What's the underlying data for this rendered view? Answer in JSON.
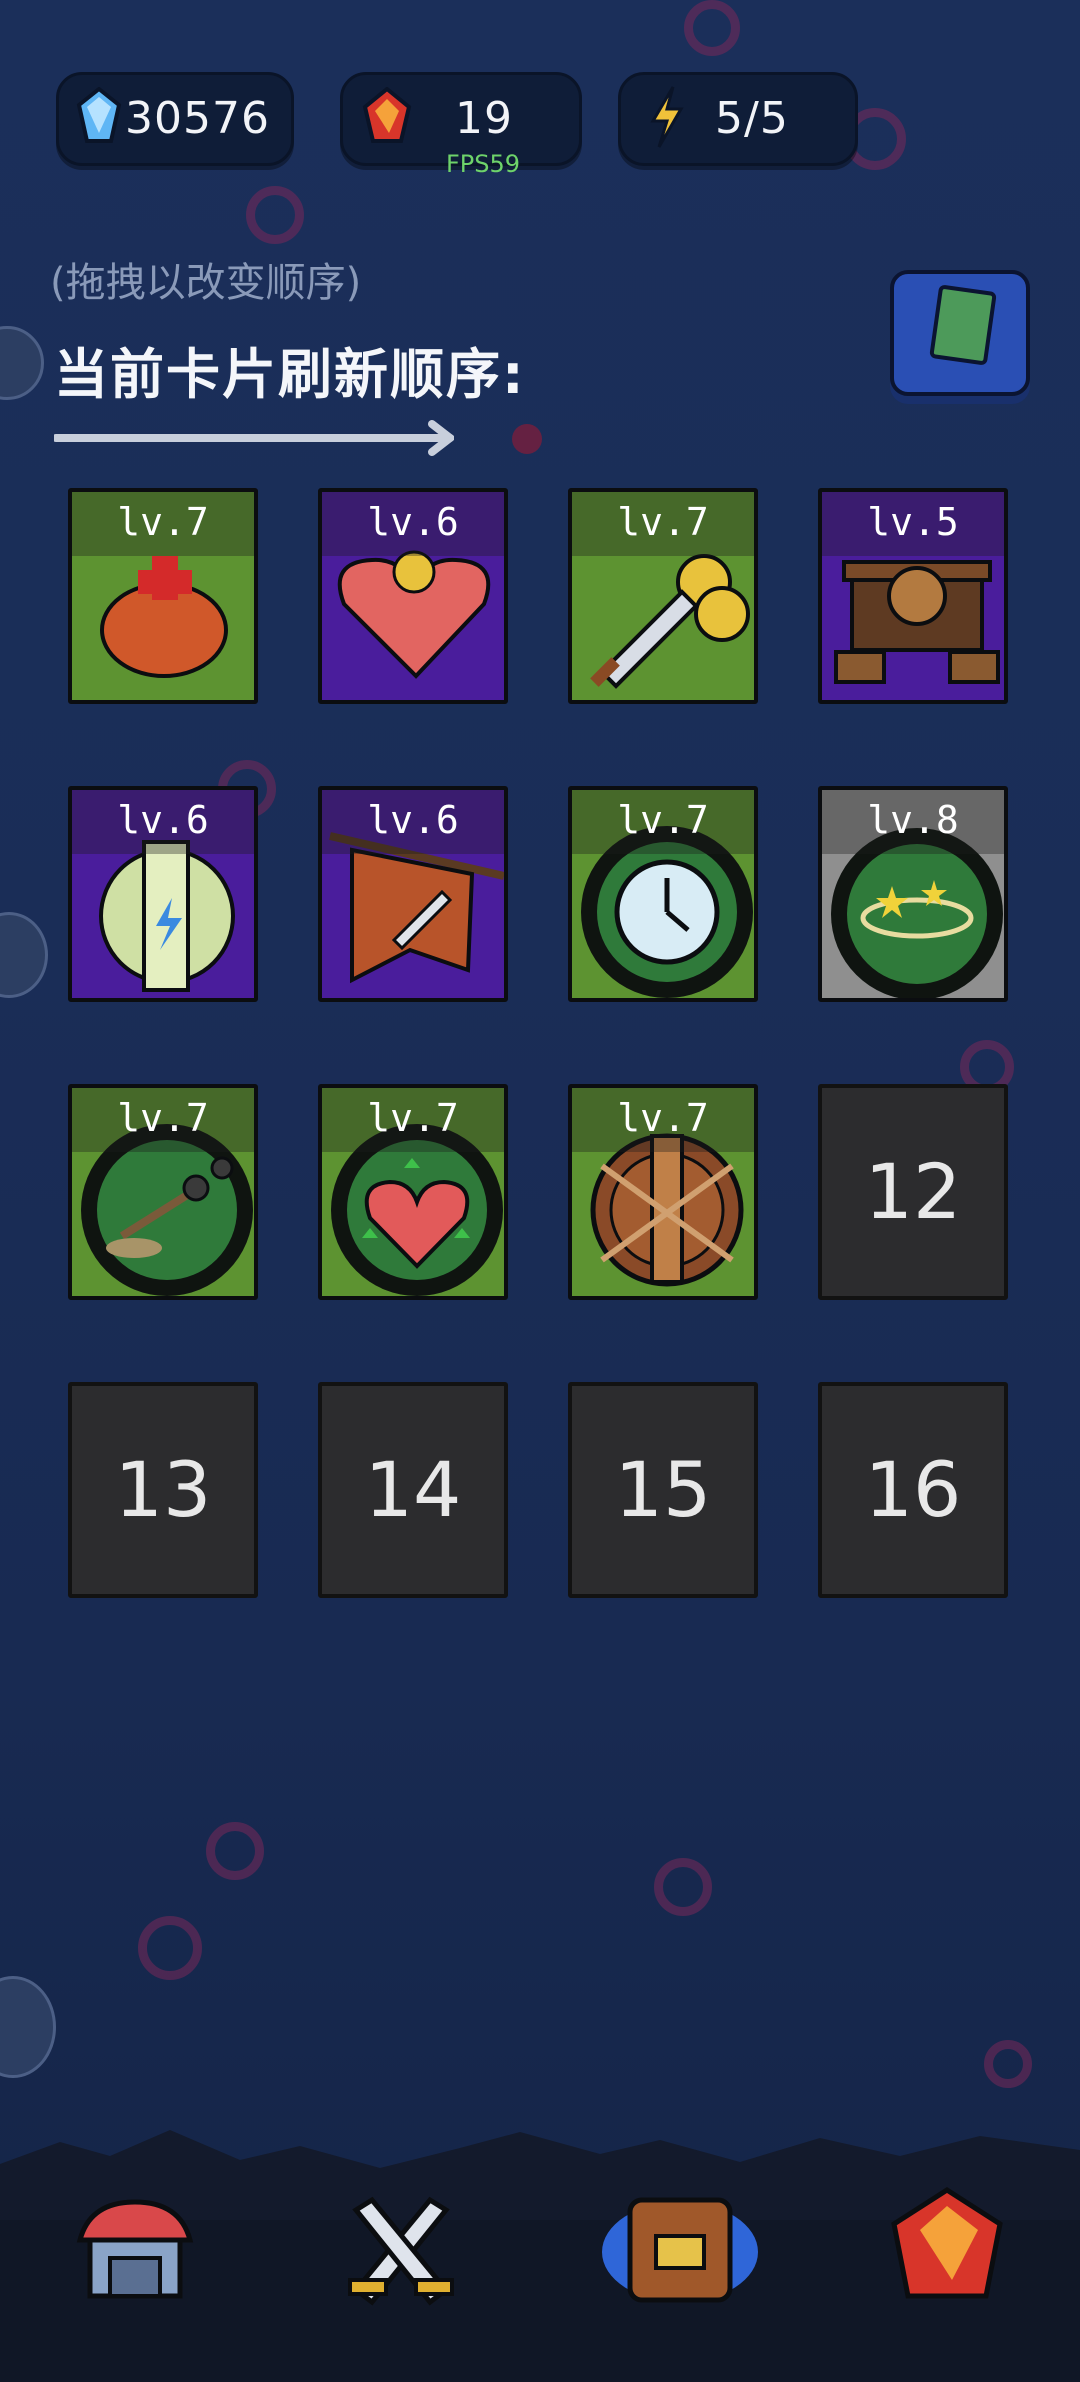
{
  "resources": {
    "gems": "30576",
    "rubies": "19",
    "energy": "5/5",
    "fps": "FPS59"
  },
  "hint": "(拖拽以改变顺序)",
  "title": "当前卡片刷新顺序:",
  "cards": [
    {
      "level": "lv.7",
      "icon": "stone-altar-icon"
    },
    {
      "level": "lv.6",
      "icon": "broken-heart-coin-icon"
    },
    {
      "level": "lv.7",
      "icon": "sword-coins-icon"
    },
    {
      "level": "lv.5",
      "icon": "ballista-cart-icon"
    },
    {
      "level": "lv.6",
      "icon": "lightning-tower-icon"
    },
    {
      "level": "lv.6",
      "icon": "war-banner-icon"
    },
    {
      "level": "lv.7",
      "icon": "clock-icon"
    },
    {
      "level": "lv.8",
      "icon": "stars-dizzy-icon"
    },
    {
      "level": "lv.7",
      "icon": "catapult-icon"
    },
    {
      "level": "lv.7",
      "icon": "heart-upgrade-icon"
    },
    {
      "level": "lv.7",
      "icon": "wooden-shield-icon"
    }
  ],
  "empty_slots": [
    "12",
    "13",
    "14",
    "15",
    "16"
  ],
  "nav": [
    "shop-icon",
    "battle-swords-icon",
    "backpack-icon",
    "ruby-crystal-icon"
  ],
  "colors": {
    "card_green": "#5d9331",
    "card_purple": "#4a1d9c",
    "card_gray": "#8f8f8f",
    "empty_slot": "#2c2c2e",
    "background": "#1a2d57"
  }
}
